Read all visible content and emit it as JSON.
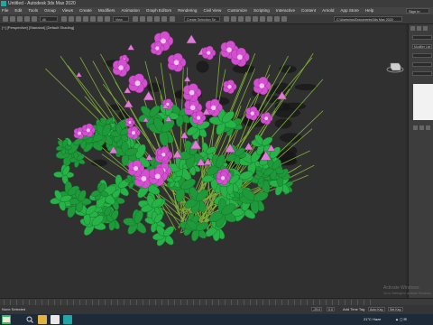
{
  "window": {
    "title": "Untitled - Autodesk 3ds Max 2020"
  },
  "menu": [
    "File",
    "Edit",
    "Tools",
    "Group",
    "Views",
    "Create",
    "Modifiers",
    "Animation",
    "Graph Editors",
    "Rendering",
    "Civil View",
    "Customize",
    "Scripting",
    "Interactive",
    "Content",
    "Arnold",
    "App Store",
    "Help"
  ],
  "account": {
    "signin_label": "Sign In"
  },
  "toolbar": {
    "filter": "All",
    "view": "View",
    "selection_set": "Create Selection Se",
    "project_path": "C:\\Users\\rus\\Documents\\3ds Max 2020"
  },
  "viewport": {
    "label": "[+] [Perspective] [Standard] [Default Shading]"
  },
  "command_panel": {
    "rollout_label": "Modifier List"
  },
  "status": {
    "selection": "None Selected",
    "x": "-29.0",
    "y": "0.0",
    "z": "0.0",
    "add_time_tag": "Add Time Tag",
    "auto_key": "Auto Key",
    "set_key": "Set Key"
  },
  "watermark": {
    "line1": "Activate Windows",
    "line2": "Go to Settings to activate Windows."
  },
  "taskbar": {
    "temperature": "21°C",
    "weather": "Haze"
  }
}
